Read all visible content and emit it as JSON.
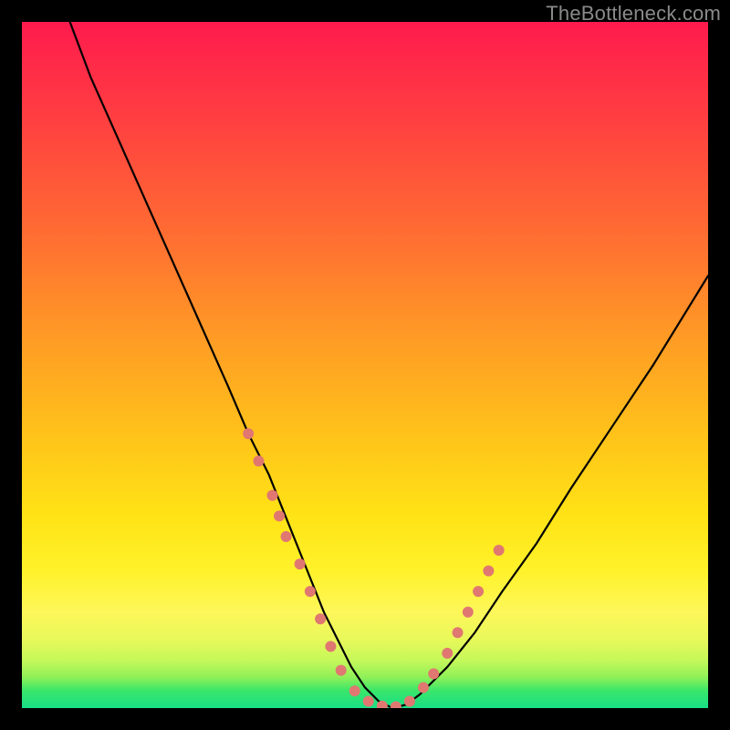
{
  "watermark": "TheBottleneck.com",
  "chart_data": {
    "type": "line",
    "title": "",
    "xlabel": "",
    "ylabel": "",
    "xlim": [
      0,
      100
    ],
    "ylim": [
      0,
      100
    ],
    "grid": false,
    "legend": false,
    "background_gradient_stops": [
      {
        "pos": 0,
        "color": "#ff1a4d"
      },
      {
        "pos": 0.45,
        "color": "#ff9826"
      },
      {
        "pos": 0.8,
        "color": "#fff22a"
      },
      {
        "pos": 0.95,
        "color": "#8ff058"
      },
      {
        "pos": 1.0,
        "color": "#18df87"
      }
    ],
    "series": [
      {
        "name": "bottleneck-curve",
        "stroke": "#000000",
        "stroke_width": 2.2,
        "x": [
          7,
          10,
          14,
          18,
          22,
          26,
          30,
          33,
          36,
          38,
          40,
          42,
          44,
          46,
          48,
          50,
          52,
          54,
          56,
          58,
          62,
          66,
          70,
          75,
          80,
          86,
          92,
          100
        ],
        "y": [
          100,
          92,
          83,
          74,
          65,
          56,
          47,
          40,
          34,
          29,
          24,
          19,
          14,
          10,
          6,
          3,
          1,
          0,
          0.5,
          2,
          6,
          11,
          17,
          24,
          32,
          41,
          50,
          63
        ]
      }
    ],
    "markers": [
      {
        "name": "highlight-dots",
        "color": "#e07871",
        "radius": 6,
        "points": [
          {
            "x": 33,
            "y": 40
          },
          {
            "x": 34.5,
            "y": 36
          },
          {
            "x": 36.5,
            "y": 31
          },
          {
            "x": 37.5,
            "y": 28
          },
          {
            "x": 38.5,
            "y": 25
          },
          {
            "x": 40.5,
            "y": 21
          },
          {
            "x": 42,
            "y": 17
          },
          {
            "x": 43.5,
            "y": 13
          },
          {
            "x": 45,
            "y": 9
          },
          {
            "x": 46.5,
            "y": 5.5
          },
          {
            "x": 48.5,
            "y": 2.5
          },
          {
            "x": 50.5,
            "y": 1
          },
          {
            "x": 52.5,
            "y": 0.3
          },
          {
            "x": 54.5,
            "y": 0.2
          },
          {
            "x": 56.5,
            "y": 1
          },
          {
            "x": 58.5,
            "y": 3
          },
          {
            "x": 60,
            "y": 5
          },
          {
            "x": 62,
            "y": 8
          },
          {
            "x": 63.5,
            "y": 11
          },
          {
            "x": 65,
            "y": 14
          },
          {
            "x": 66.5,
            "y": 17
          },
          {
            "x": 68,
            "y": 20
          },
          {
            "x": 69.5,
            "y": 23
          }
        ]
      }
    ]
  }
}
